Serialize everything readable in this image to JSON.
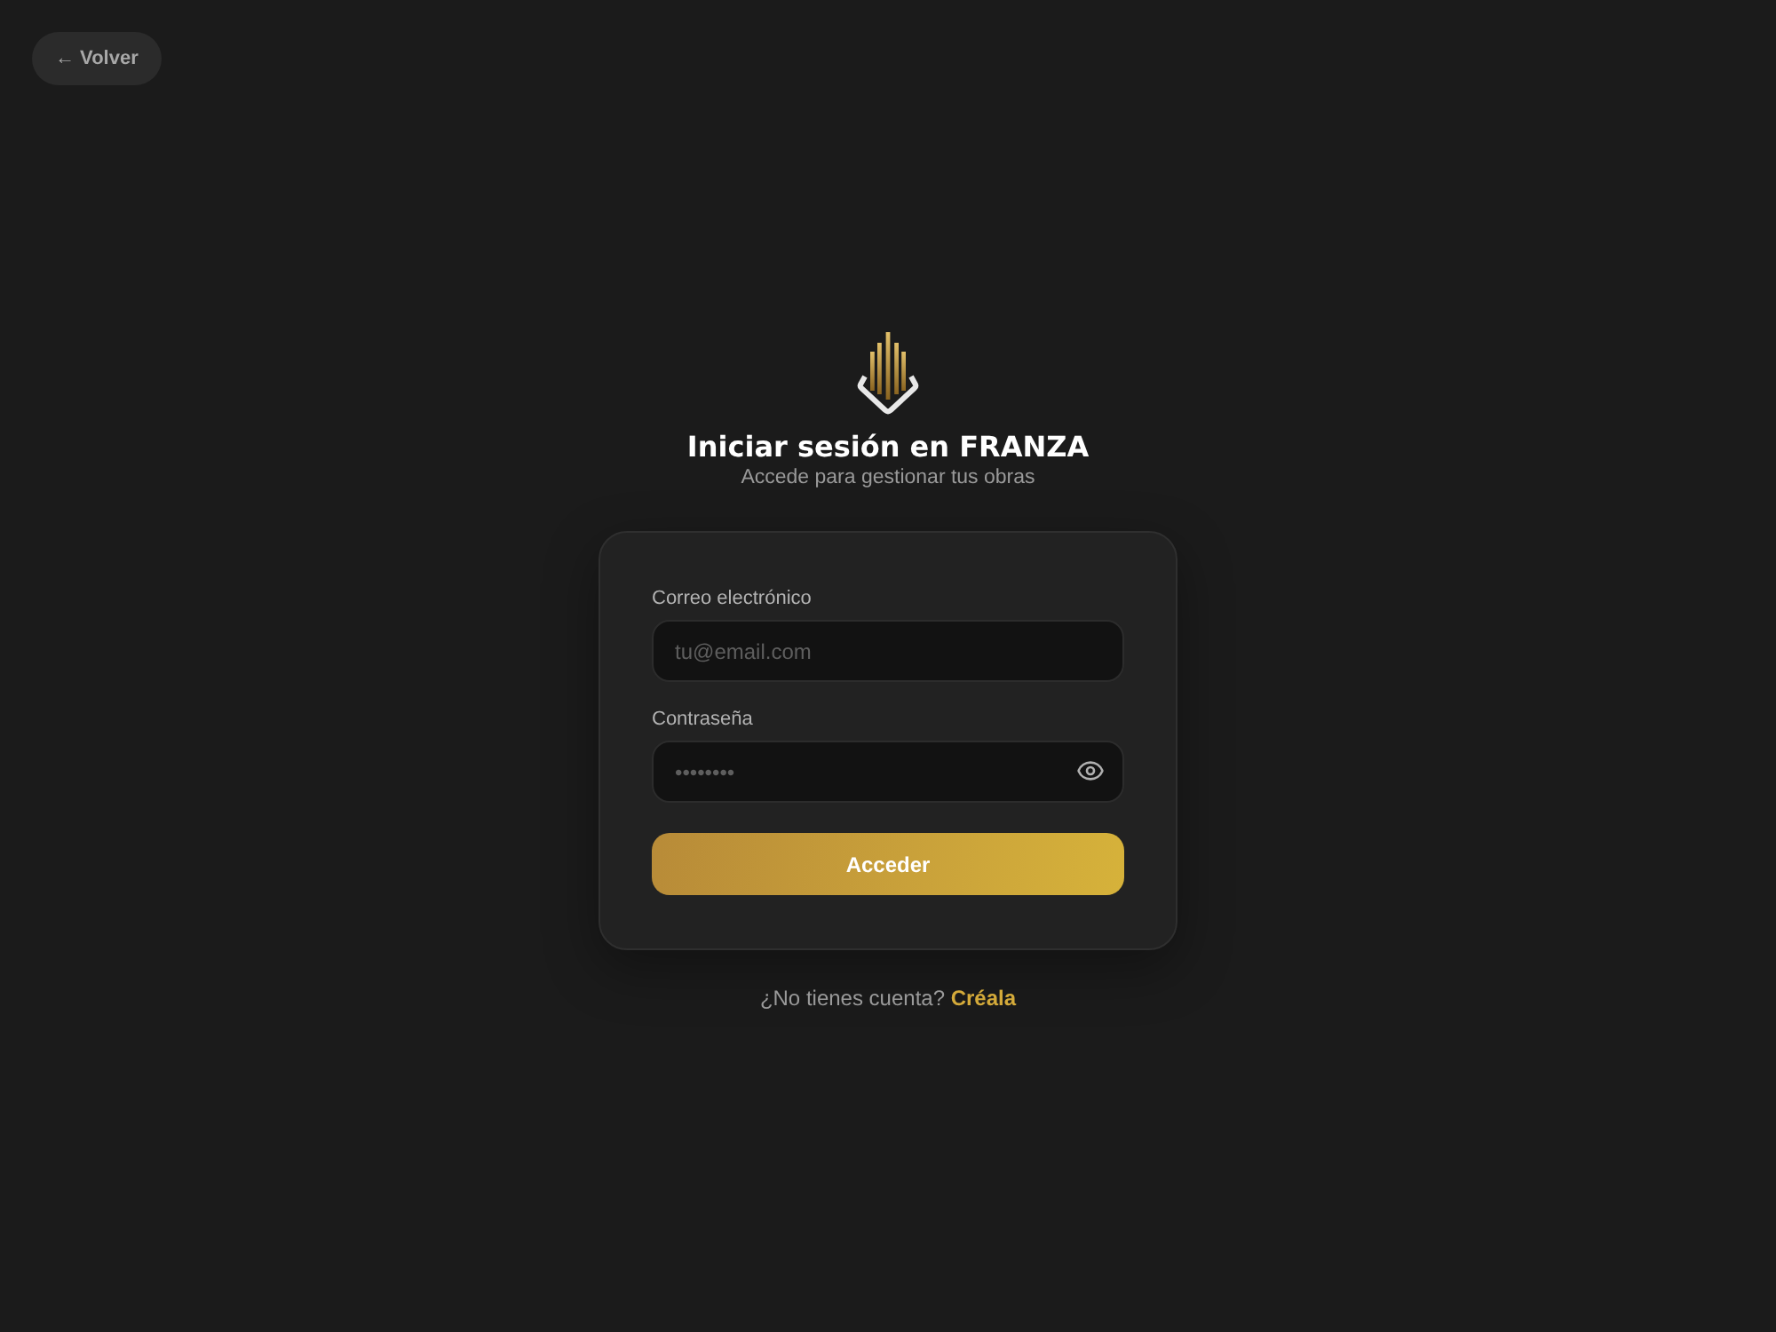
{
  "back_button": {
    "label": "← Volver"
  },
  "header": {
    "title": "Iniciar sesión en FRANZA",
    "subtitle": "Accede para gestionar tus obras"
  },
  "form": {
    "fields": [
      {
        "kind": "email",
        "label": "Correo electrónico",
        "placeholder": "tu@email.com"
      },
      {
        "kind": "password",
        "label": "Contraseña",
        "placeholder": "••••••••"
      }
    ],
    "submit": {
      "label": "Acceder"
    }
  },
  "footer": {
    "prompt": "¿No tienes cuenta?",
    "link": "Créala"
  }
}
